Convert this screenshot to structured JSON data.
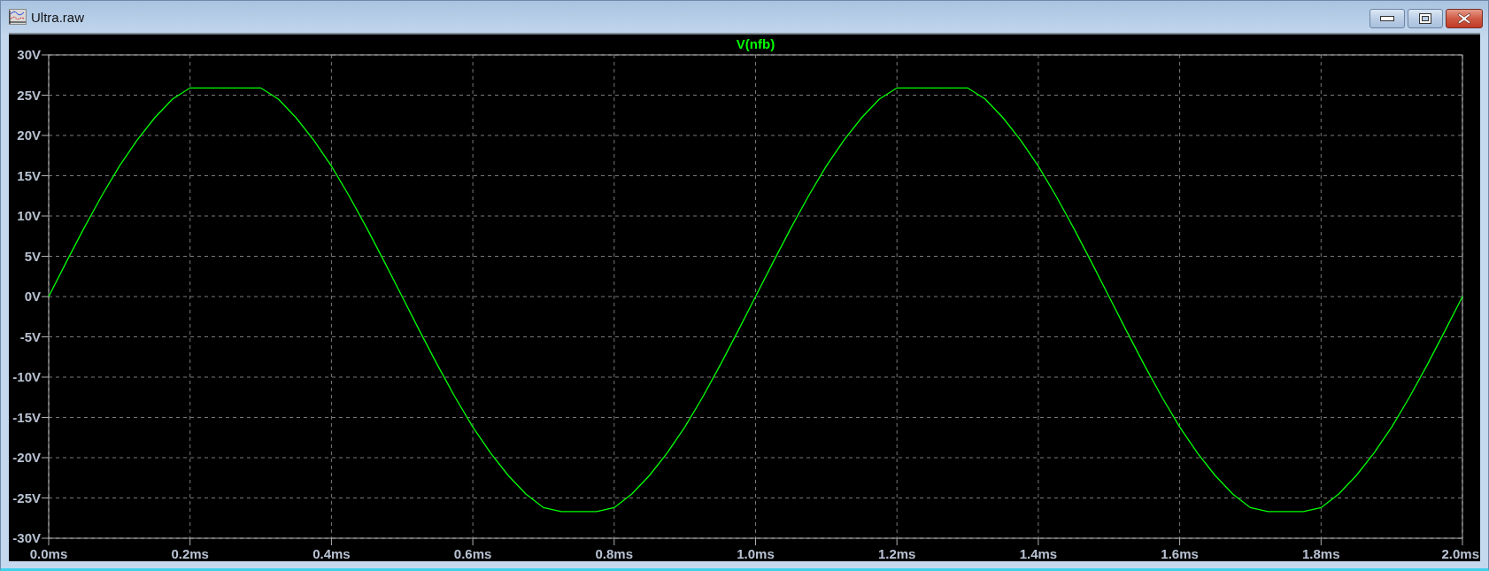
{
  "window": {
    "title": "Ultra.raw"
  },
  "plot": {
    "chart_data": {
      "type": "line",
      "title": "V(nfb)",
      "grid": true,
      "xlim": [
        0,
        2
      ],
      "ylim": [
        -30,
        30
      ],
      "xticks": [
        {
          "value": 0,
          "label": "0.0ms"
        },
        {
          "value": 0.2,
          "label": "0.2ms"
        },
        {
          "value": 0.4,
          "label": "0.4ms"
        },
        {
          "value": 0.6,
          "label": "0.6ms"
        },
        {
          "value": 0.8,
          "label": "0.8ms"
        },
        {
          "value": 1.0,
          "label": "1.0ms"
        },
        {
          "value": 1.2,
          "label": "1.2ms"
        },
        {
          "value": 1.4,
          "label": "1.4ms"
        },
        {
          "value": 1.6,
          "label": "1.6ms"
        },
        {
          "value": 1.8,
          "label": "1.8ms"
        },
        {
          "value": 2.0,
          "label": "2.0ms"
        }
      ],
      "yticks": [
        {
          "value": 30,
          "label": "30V"
        },
        {
          "value": 25,
          "label": "25V"
        },
        {
          "value": 20,
          "label": "20V"
        },
        {
          "value": 15,
          "label": "15V"
        },
        {
          "value": 10,
          "label": "10V"
        },
        {
          "value": 5,
          "label": "5V"
        },
        {
          "value": 0,
          "label": "0V"
        },
        {
          "value": -5,
          "label": "-5V"
        },
        {
          "value": -10,
          "label": "-10V"
        },
        {
          "value": -15,
          "label": "-15V"
        },
        {
          "value": -20,
          "label": "-20V"
        },
        {
          "value": -25,
          "label": "-25V"
        },
        {
          "value": -30,
          "label": "-30V"
        }
      ],
      "x": [
        0,
        0.025,
        0.05,
        0.075,
        0.1,
        0.125,
        0.15,
        0.175,
        0.2,
        0.225,
        0.25,
        0.275,
        0.3,
        0.325,
        0.35,
        0.375,
        0.4,
        0.425,
        0.45,
        0.475,
        0.5,
        0.525,
        0.55,
        0.575,
        0.6,
        0.625,
        0.65,
        0.675,
        0.7,
        0.725,
        0.75,
        0.775,
        0.8,
        0.825,
        0.85,
        0.875,
        0.9,
        0.925,
        0.95,
        0.975,
        1.0,
        1.025,
        1.05,
        1.075,
        1.1,
        1.125,
        1.15,
        1.175,
        1.2,
        1.225,
        1.25,
        1.275,
        1.3,
        1.325,
        1.35,
        1.375,
        1.4,
        1.425,
        1.45,
        1.475,
        1.5,
        1.525,
        1.55,
        1.575,
        1.6,
        1.625,
        1.65,
        1.675,
        1.7,
        1.725,
        1.75,
        1.775,
        1.8,
        1.825,
        1.85,
        1.875,
        1.9,
        1.925,
        1.95,
        1.975,
        2.0
      ],
      "series": [
        {
          "color": "#00ff00",
          "values": [
            0,
            4.3,
            8.5,
            12.5,
            16.2,
            19.4,
            22.2,
            24.5,
            25.9,
            25.9,
            25.9,
            25.9,
            25.9,
            24.5,
            22.2,
            19.4,
            16.2,
            12.5,
            8.5,
            4.3,
            0,
            -4.3,
            -8.5,
            -12.5,
            -16.2,
            -19.4,
            -22.2,
            -24.5,
            -26.2,
            -26.7,
            -26.7,
            -26.7,
            -26.2,
            -24.5,
            -22.2,
            -19.4,
            -16.2,
            -12.5,
            -8.5,
            -4.3,
            0,
            4.3,
            8.5,
            12.5,
            16.2,
            19.4,
            22.2,
            24.5,
            25.9,
            25.9,
            25.9,
            25.9,
            25.9,
            24.5,
            22.2,
            19.4,
            16.2,
            12.5,
            8.5,
            4.3,
            0,
            -4.3,
            -8.5,
            -12.5,
            -16.2,
            -19.4,
            -22.2,
            -24.5,
            -26.2,
            -26.7,
            -26.7,
            -26.7,
            -26.2,
            -24.5,
            -22.2,
            -19.4,
            -16.2,
            -12.5,
            -8.5,
            -4.3,
            0
          ]
        }
      ]
    }
  }
}
